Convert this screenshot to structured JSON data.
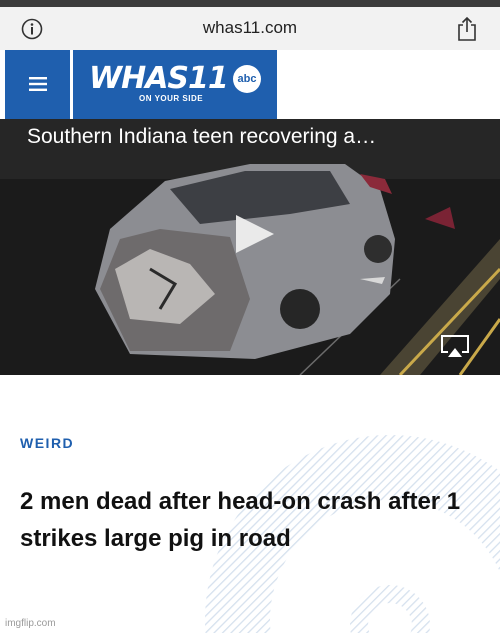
{
  "browser": {
    "url": "whas11.com"
  },
  "site": {
    "logo_text": "WHAS11",
    "logo_badge": "abc",
    "tagline": "ON YOUR SIDE"
  },
  "video": {
    "title": "Southern Indiana teen recovering a…"
  },
  "article": {
    "category": "WEIRD",
    "headline": "2 men dead after head-on crash after 1 strikes large pig in road"
  },
  "watermark": "imgflip.com",
  "colors": {
    "brand_blue": "#1f5fae",
    "browser_bar": "#f2f2f2"
  }
}
